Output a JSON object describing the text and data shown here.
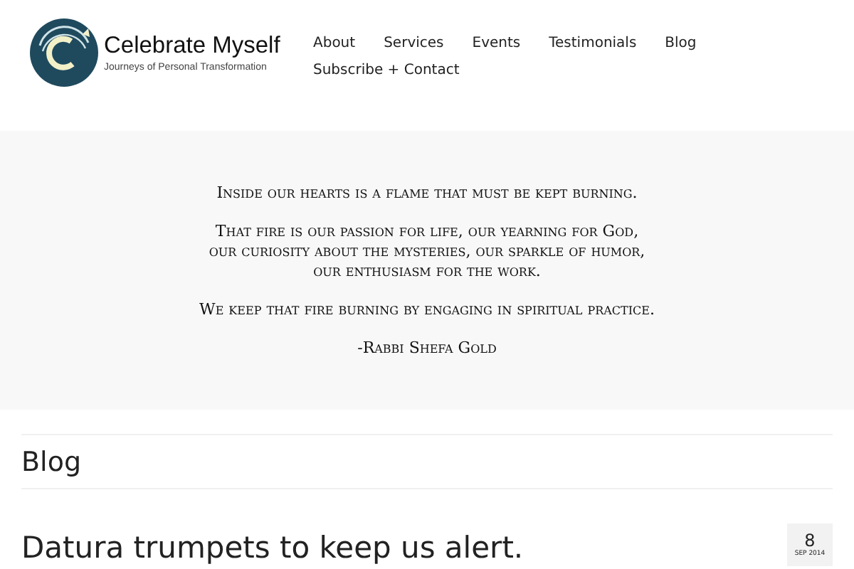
{
  "logo": {
    "title": "Celebrate Myself",
    "tagline": "Journeys of Personal Transformation"
  },
  "nav": [
    {
      "label": "About"
    },
    {
      "label": "Services"
    },
    {
      "label": "Events"
    },
    {
      "label": "Testimonials"
    },
    {
      "label": "Blog"
    },
    {
      "label": "Subscribe + Contact"
    }
  ],
  "quote": {
    "paragraphs": [
      [
        "Inside our hearts is a flame that must be kept burning."
      ],
      [
        "That fire is our passion for life, our yearning for God,",
        "our curiosity about the mysteries, our sparkle of humor,",
        "our enthusiasm for the work."
      ],
      [
        "We keep that fire burning by engaging in spiritual practice."
      ],
      [
        "-Rabbi Shefa Gold"
      ]
    ]
  },
  "section_title": "Blog",
  "post": {
    "title": "Datura trumpets to keep us alert.",
    "date": {
      "day": "8",
      "month_year": "SEP 2014"
    }
  }
}
